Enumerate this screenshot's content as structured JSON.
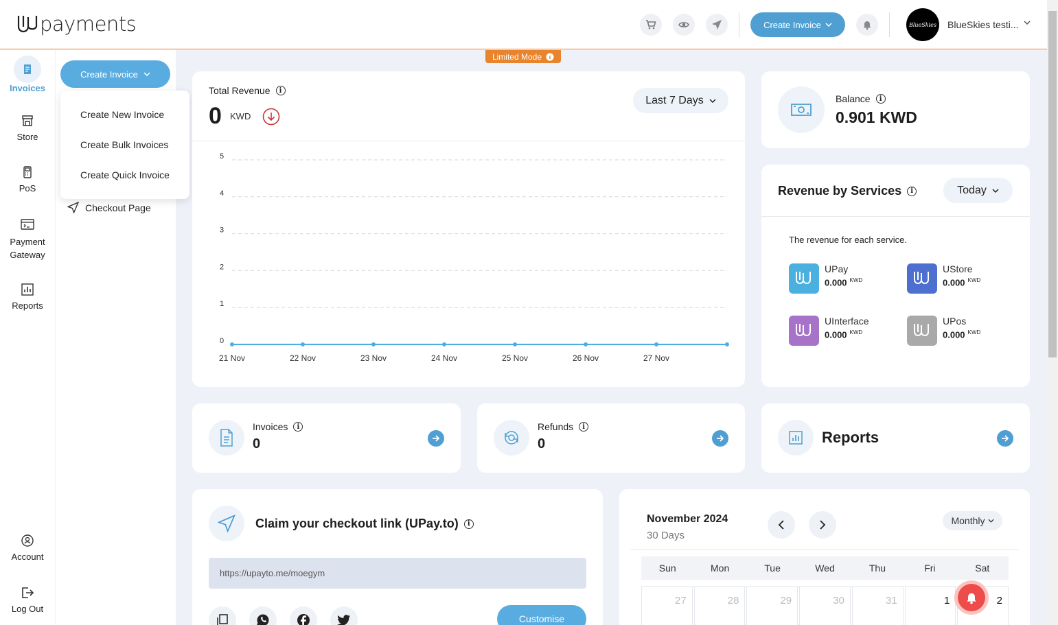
{
  "header": {
    "logo_text": "payments",
    "create_invoice": "Create Invoice",
    "user_name": "BlueSkies testi...",
    "avatar_text": "BlueSkies"
  },
  "rail": {
    "invoices": "Invoices",
    "store": "Store",
    "pos": "PoS",
    "payment_gateway_1": "Payment",
    "payment_gateway_2": "Gateway",
    "reports": "Reports",
    "account": "Account",
    "logout": "Log Out"
  },
  "submenu": {
    "create_invoice": "Create Invoice",
    "items": [
      "Create New Invoice",
      "Create Bulk Invoices",
      "Create Quick Invoice"
    ],
    "checkout_page": "Checkout Page"
  },
  "limited_mode": "Limited Mode",
  "total_revenue": {
    "title": "Total Revenue",
    "value": "0",
    "unit": "KWD",
    "range": "Last 7 Days"
  },
  "chart_data": {
    "type": "line",
    "categories": [
      "21 Nov",
      "22 Nov",
      "23 Nov",
      "24 Nov",
      "25 Nov",
      "26 Nov",
      "27 Nov",
      ""
    ],
    "series": [
      {
        "values": [
          0,
          0,
          0,
          0,
          0,
          0,
          0,
          0
        ]
      }
    ],
    "yticks": [
      "0",
      "1",
      "2",
      "3",
      "4",
      "5"
    ],
    "ylim": [
      0,
      5
    ],
    "grid": true,
    "color": "#4aaee0"
  },
  "balance": {
    "label": "Balance",
    "value": "0.901 KWD"
  },
  "revenue_by_services": {
    "title": "Revenue by Services",
    "range": "Today",
    "description": "The revenue for each service.",
    "services": [
      {
        "name": "UPay",
        "value": "0.000",
        "unit": "KWD",
        "color": "#4ab0df"
      },
      {
        "name": "UStore",
        "value": "0.000",
        "unit": "KWD",
        "color": "#4d6fd0"
      },
      {
        "name": "UInterface",
        "value": "0.000",
        "unit": "KWD",
        "color": "#a673c9"
      },
      {
        "name": "UPos",
        "value": "0.000",
        "unit": "KWD",
        "color": "#a9a9a9"
      }
    ]
  },
  "stats": {
    "invoices_label": "Invoices",
    "invoices_value": "0",
    "refunds_label": "Refunds",
    "refunds_value": "0",
    "reports_label": "Reports"
  },
  "claim": {
    "title": "Claim your checkout link (UPay.to)",
    "link": "https://upayto.me/moegym",
    "customise": "Customise"
  },
  "calendar": {
    "month": "November 2024",
    "days_count": "30 Days",
    "view": "Monthly",
    "weekdays": [
      "Sun",
      "Mon",
      "Tue",
      "Wed",
      "Thu",
      "Fri",
      "Sat"
    ],
    "first_row": [
      "27",
      "28",
      "29",
      "30",
      "31",
      "1",
      "2"
    ]
  },
  "colors": {
    "accent": "#4f9fd3",
    "limited": "#e8842e",
    "header_border": "#e8893d"
  }
}
